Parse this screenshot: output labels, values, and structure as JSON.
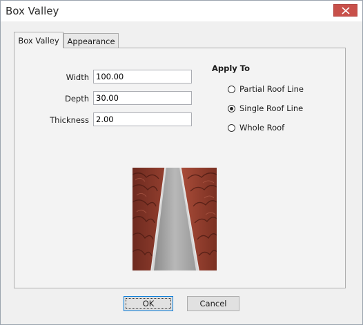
{
  "window": {
    "title": "Box Valley"
  },
  "tabs": [
    {
      "label": "Box Valley",
      "active": true
    },
    {
      "label": "Appearance",
      "active": false
    }
  ],
  "fields": {
    "width": {
      "label": "Width",
      "value": "100.00"
    },
    "depth": {
      "label": "Depth",
      "value": "30.00"
    },
    "thickness": {
      "label": "Thickness",
      "value": "2.00"
    }
  },
  "apply_to": {
    "title": "Apply To",
    "options": [
      {
        "label": "Partial Roof Line",
        "selected": false
      },
      {
        "label": "Single Roof Line",
        "selected": true
      },
      {
        "label": "Whole Roof",
        "selected": false
      }
    ]
  },
  "buttons": {
    "ok": "OK",
    "cancel": "Cancel"
  },
  "colors": {
    "close_button": "#c8504a",
    "roof_tile": "#8e3a2b",
    "valley_metal": "#b0b0b0"
  }
}
